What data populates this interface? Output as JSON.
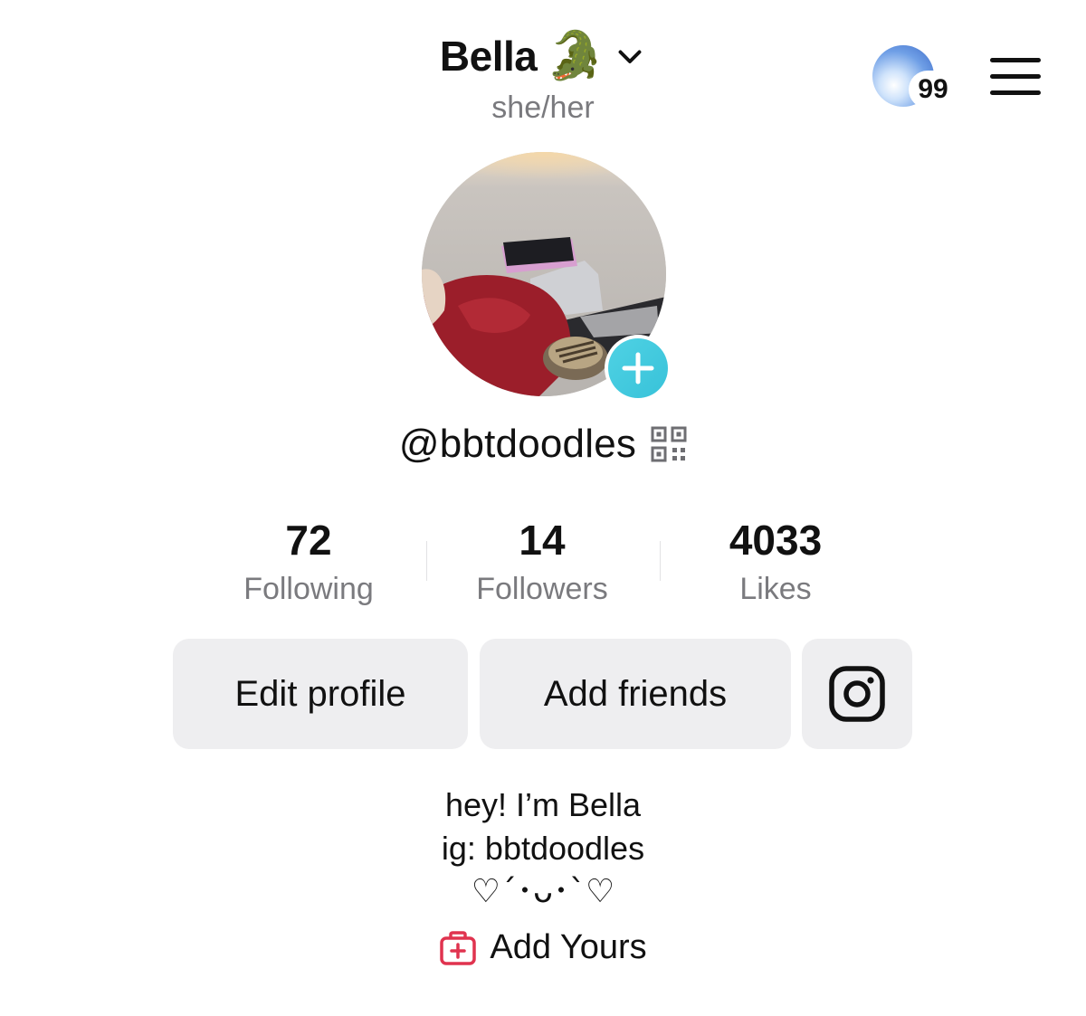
{
  "header": {
    "display_name": "Bella",
    "emoji": "🐊",
    "pronouns": "she/her"
  },
  "notifications": {
    "count": "99"
  },
  "profile": {
    "handle": "@bbtdoodles"
  },
  "stats": [
    {
      "value": "72",
      "label": "Following"
    },
    {
      "value": "14",
      "label": "Followers"
    },
    {
      "value": "4033",
      "label": "Likes"
    }
  ],
  "actions": {
    "edit_profile": "Edit profile",
    "add_friends": "Add friends"
  },
  "bio": {
    "line1": "hey! I’m Bella",
    "line2": "ig: bbtdoodles",
    "line3": "♡´･ᴗ･`♡"
  },
  "add_yours": {
    "label": "Add Yours"
  },
  "colors": {
    "accent_teal": "#3fc8dc",
    "add_yours_red": "#e0334f",
    "button_bg": "#eeeef0",
    "muted_text": "#7a7a7e"
  },
  "icons": [
    "chevron-down-icon",
    "hamburger-menu-icon",
    "plus-icon",
    "qr-code-icon",
    "instagram-icon",
    "add-yours-icon"
  ]
}
